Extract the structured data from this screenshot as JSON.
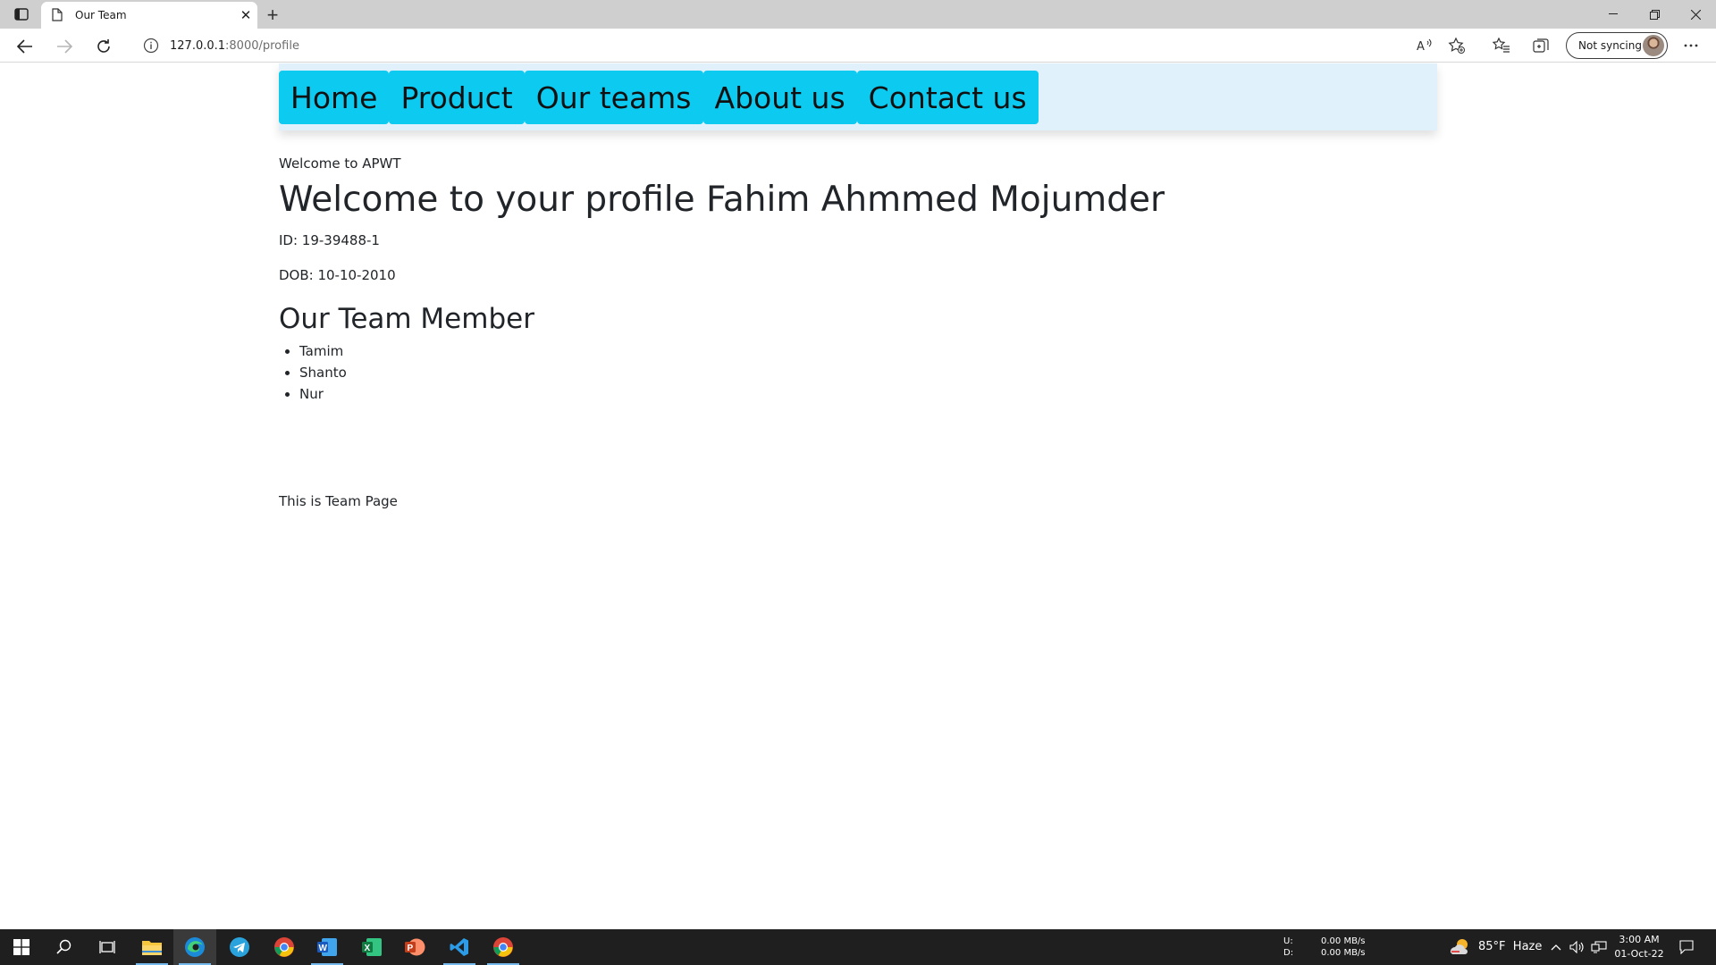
{
  "browser": {
    "tab_title": "Our Team",
    "url_host": "127.0.0.1",
    "url_path": ":8000/profile",
    "sync_label": "Not syncing"
  },
  "nav": {
    "items": [
      {
        "label": "Home"
      },
      {
        "label": "Product"
      },
      {
        "label": "Our teams"
      },
      {
        "label": "About us"
      },
      {
        "label": "Contact us"
      }
    ],
    "button_color": "#0dcaf0",
    "bar_color": "#e1f1fb"
  },
  "main": {
    "welcome_small": "Welcome to APWT",
    "profile_title": "Welcome to your profile Fahim Ahmmed Mojumder",
    "id_line": "ID: 19-39488-1",
    "dob_line": "DOB: 10-10-2010",
    "team_title": "Our Team Member",
    "team_members": [
      "Tamim",
      "Shanto",
      "Nur"
    ],
    "footer_text": "This is Team Page"
  },
  "taskbar": {
    "apps": [
      "start-icon",
      "search-icon",
      "task-view-icon",
      "file-explorer-icon",
      "edge-icon",
      "telegram-icon",
      "chrome-icon",
      "word-icon",
      "excel-icon",
      "powerpoint-icon",
      "vscode-icon",
      "chrome-icon"
    ],
    "net_up_label": "U:",
    "net_down_label": "D:",
    "net_up_value": "0.00 MB/s",
    "net_down_value": "0.00 MB/s",
    "weather_temp": "85°F",
    "weather_desc": "Haze",
    "time": "3:00 AM",
    "date": "01-Oct-22"
  }
}
